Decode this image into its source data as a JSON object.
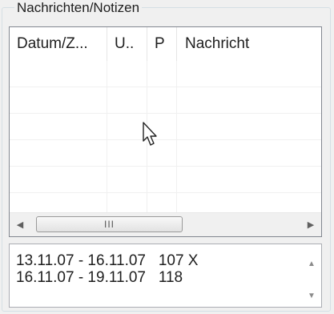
{
  "group": {
    "title": "Nachrichten/Notizen"
  },
  "list": {
    "columns": [
      "Datum/Z...",
      "U..",
      "P",
      "Nachricht"
    ],
    "row_count": 6,
    "hscroll": {
      "left_icon": "scroll-left-icon",
      "right_icon": "scroll-right-icon",
      "thumb_grip": "III"
    }
  },
  "notes": {
    "lines": [
      "13.11.07 - 16.11.07   107 X",
      "16.11.07 - 19.11.07   118"
    ],
    "vscroll": {
      "up_icon": "scroll-up-icon",
      "down_icon": "scroll-down-icon"
    }
  }
}
